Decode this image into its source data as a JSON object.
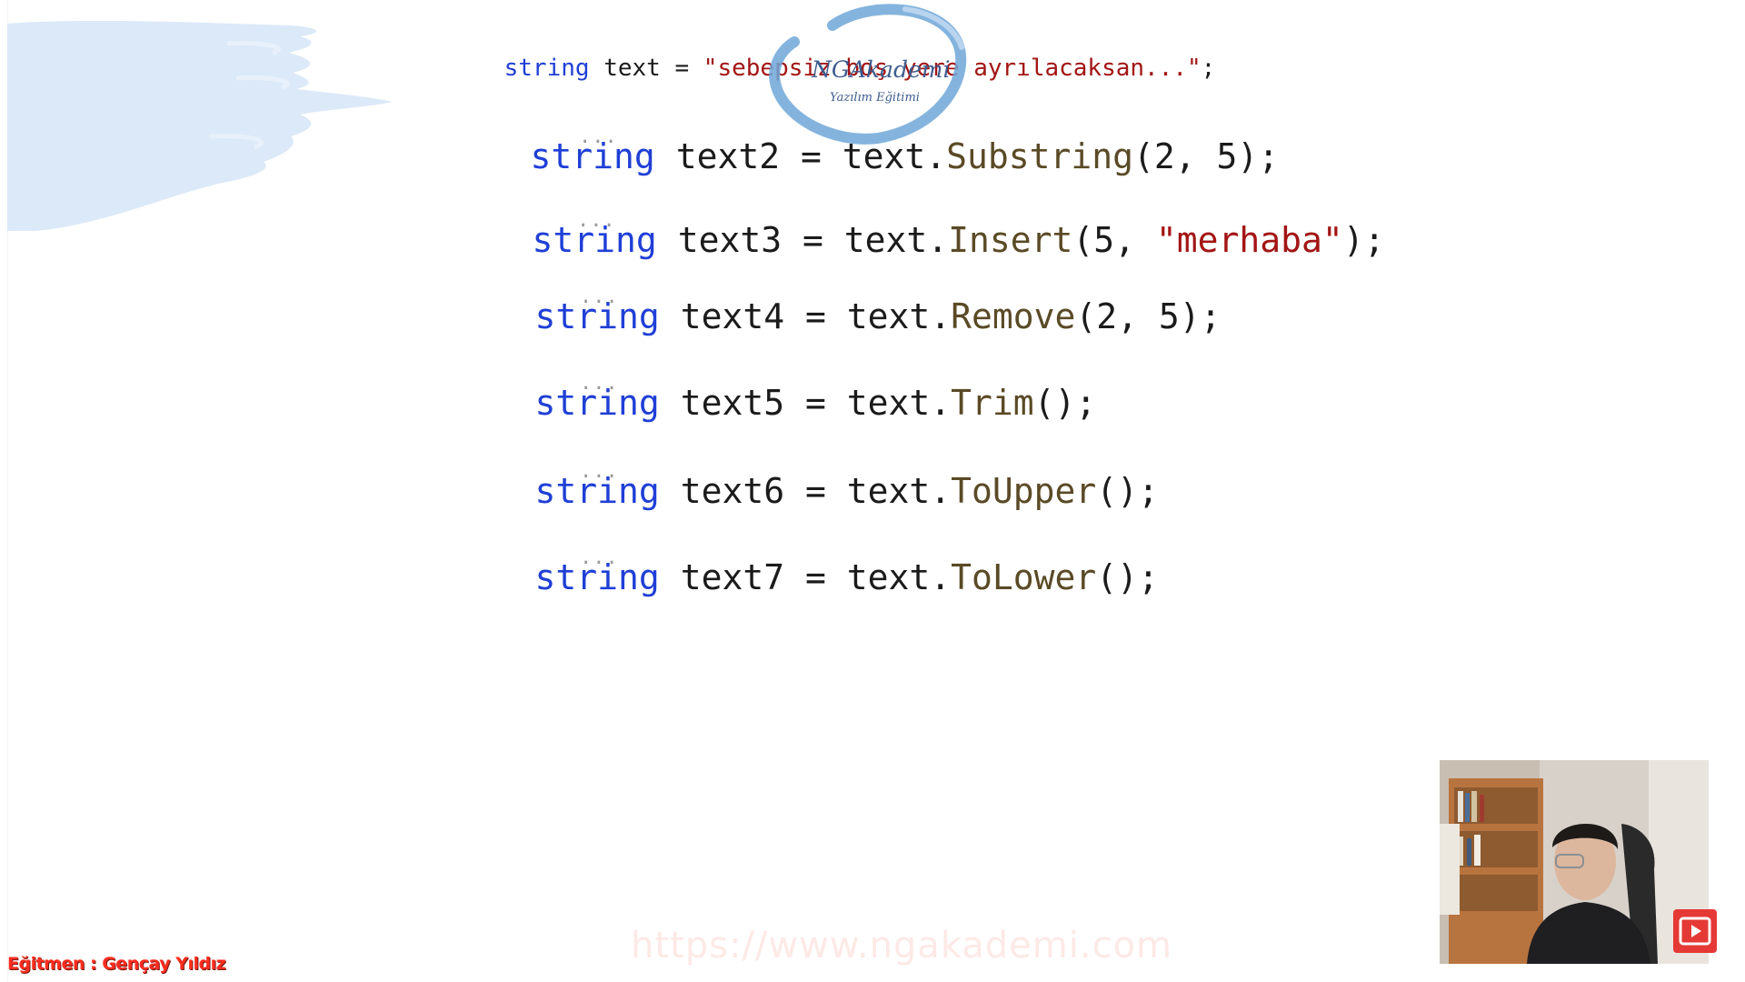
{
  "colors": {
    "keyword": "#1f3fd6",
    "string_literal": "#a31515",
    "method": "#5a4a26",
    "plain": "#1b1b1b",
    "brand": "#3d5d8f",
    "instructor_red": "#ff2d1f"
  },
  "code": {
    "line1": {
      "kw": "string",
      "var": "text",
      "eq": " = ",
      "lit": "\"sebepsiz boş yere ayrılacaksan...\"",
      "end": ";"
    },
    "line2": {
      "kw": "string",
      "var": "text2",
      "eq": " = ",
      "obj": "text.",
      "method": "Substring",
      "args": "(2, 5);"
    },
    "line3": {
      "kw": "string",
      "var": "text3",
      "eq": " = ",
      "obj": "text.",
      "method": "Insert",
      "args_a": "(5, ",
      "lit": "\"merhaba\"",
      "args_b": ");"
    },
    "line4": {
      "kw": "string",
      "var": "text4",
      "eq": " = ",
      "obj": "text.",
      "method": "Remove",
      "args": "(2, 5);"
    },
    "line5": {
      "kw": "string",
      "var": "text5",
      "eq": " = ",
      "obj": "text.",
      "method": "Trim",
      "args": "();"
    },
    "line6": {
      "kw": "string",
      "var": "text6",
      "eq": " = ",
      "obj": "text.",
      "method": "ToUpper",
      "args": "();"
    },
    "line7": {
      "kw": "string",
      "var": "text7",
      "eq": " = ",
      "obj": "text.",
      "method": "ToLower",
      "args": "();"
    },
    "dots": "..."
  },
  "logo": {
    "name": "NGAkademi",
    "tagline": "Yazılım Eğitimi"
  },
  "watermark": "https://www.ngakademi.com",
  "instructor": "Eğitmen : Gençay Yıldız",
  "icons": {
    "play": "play-icon"
  }
}
